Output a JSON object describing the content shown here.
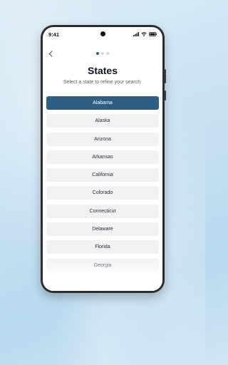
{
  "status_bar": {
    "time": "9:41"
  },
  "header": {
    "title": "States",
    "subtitle": "Select a state to refine your search."
  },
  "pagination": {
    "total": 3,
    "active": 1
  },
  "states": [
    {
      "label": "Alabama",
      "selected": true
    },
    {
      "label": "Alaska",
      "selected": false
    },
    {
      "label": "Arizona",
      "selected": false
    },
    {
      "label": "Arkansas",
      "selected": false
    },
    {
      "label": "California",
      "selected": false
    },
    {
      "label": "Colorado",
      "selected": false
    },
    {
      "label": "Connecticut",
      "selected": false
    },
    {
      "label": "Delaware",
      "selected": false
    },
    {
      "label": "Florida",
      "selected": false
    },
    {
      "label": "Georgia",
      "selected": false
    }
  ],
  "colors": {
    "accent": "#2f5e85",
    "item_bg": "#f1f2f4"
  },
  "icons": {
    "back": "chevron-left-icon"
  }
}
